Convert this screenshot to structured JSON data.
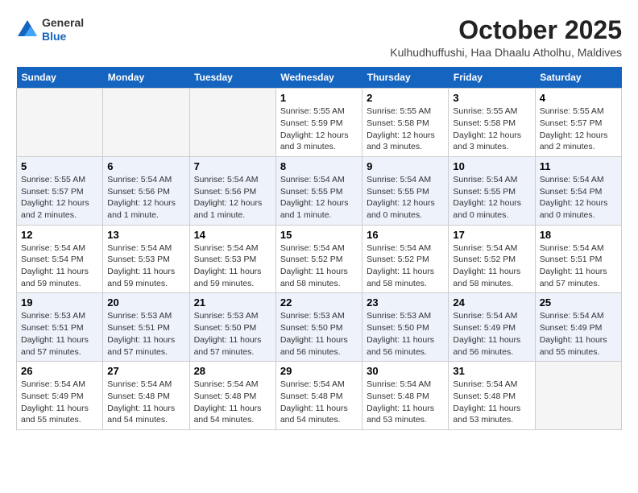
{
  "logo": {
    "general": "General",
    "blue": "Blue"
  },
  "header": {
    "month_year": "October 2025",
    "location": "Kulhudhuffushi, Haa Dhaalu Atholhu, Maldives"
  },
  "weekdays": [
    "Sunday",
    "Monday",
    "Tuesday",
    "Wednesday",
    "Thursday",
    "Friday",
    "Saturday"
  ],
  "weeks": [
    [
      {
        "day": "",
        "info": ""
      },
      {
        "day": "",
        "info": ""
      },
      {
        "day": "",
        "info": ""
      },
      {
        "day": "1",
        "info": "Sunrise: 5:55 AM\nSunset: 5:59 PM\nDaylight: 12 hours\nand 3 minutes."
      },
      {
        "day": "2",
        "info": "Sunrise: 5:55 AM\nSunset: 5:58 PM\nDaylight: 12 hours\nand 3 minutes."
      },
      {
        "day": "3",
        "info": "Sunrise: 5:55 AM\nSunset: 5:58 PM\nDaylight: 12 hours\nand 3 minutes."
      },
      {
        "day": "4",
        "info": "Sunrise: 5:55 AM\nSunset: 5:57 PM\nDaylight: 12 hours\nand 2 minutes."
      }
    ],
    [
      {
        "day": "5",
        "info": "Sunrise: 5:55 AM\nSunset: 5:57 PM\nDaylight: 12 hours\nand 2 minutes."
      },
      {
        "day": "6",
        "info": "Sunrise: 5:54 AM\nSunset: 5:56 PM\nDaylight: 12 hours\nand 1 minute."
      },
      {
        "day": "7",
        "info": "Sunrise: 5:54 AM\nSunset: 5:56 PM\nDaylight: 12 hours\nand 1 minute."
      },
      {
        "day": "8",
        "info": "Sunrise: 5:54 AM\nSunset: 5:55 PM\nDaylight: 12 hours\nand 1 minute."
      },
      {
        "day": "9",
        "info": "Sunrise: 5:54 AM\nSunset: 5:55 PM\nDaylight: 12 hours\nand 0 minutes."
      },
      {
        "day": "10",
        "info": "Sunrise: 5:54 AM\nSunset: 5:55 PM\nDaylight: 12 hours\nand 0 minutes."
      },
      {
        "day": "11",
        "info": "Sunrise: 5:54 AM\nSunset: 5:54 PM\nDaylight: 12 hours\nand 0 minutes."
      }
    ],
    [
      {
        "day": "12",
        "info": "Sunrise: 5:54 AM\nSunset: 5:54 PM\nDaylight: 11 hours\nand 59 minutes."
      },
      {
        "day": "13",
        "info": "Sunrise: 5:54 AM\nSunset: 5:53 PM\nDaylight: 11 hours\nand 59 minutes."
      },
      {
        "day": "14",
        "info": "Sunrise: 5:54 AM\nSunset: 5:53 PM\nDaylight: 11 hours\nand 59 minutes."
      },
      {
        "day": "15",
        "info": "Sunrise: 5:54 AM\nSunset: 5:52 PM\nDaylight: 11 hours\nand 58 minutes."
      },
      {
        "day": "16",
        "info": "Sunrise: 5:54 AM\nSunset: 5:52 PM\nDaylight: 11 hours\nand 58 minutes."
      },
      {
        "day": "17",
        "info": "Sunrise: 5:54 AM\nSunset: 5:52 PM\nDaylight: 11 hours\nand 58 minutes."
      },
      {
        "day": "18",
        "info": "Sunrise: 5:54 AM\nSunset: 5:51 PM\nDaylight: 11 hours\nand 57 minutes."
      }
    ],
    [
      {
        "day": "19",
        "info": "Sunrise: 5:53 AM\nSunset: 5:51 PM\nDaylight: 11 hours\nand 57 minutes."
      },
      {
        "day": "20",
        "info": "Sunrise: 5:53 AM\nSunset: 5:51 PM\nDaylight: 11 hours\nand 57 minutes."
      },
      {
        "day": "21",
        "info": "Sunrise: 5:53 AM\nSunset: 5:50 PM\nDaylight: 11 hours\nand 57 minutes."
      },
      {
        "day": "22",
        "info": "Sunrise: 5:53 AM\nSunset: 5:50 PM\nDaylight: 11 hours\nand 56 minutes."
      },
      {
        "day": "23",
        "info": "Sunrise: 5:53 AM\nSunset: 5:50 PM\nDaylight: 11 hours\nand 56 minutes."
      },
      {
        "day": "24",
        "info": "Sunrise: 5:54 AM\nSunset: 5:49 PM\nDaylight: 11 hours\nand 56 minutes."
      },
      {
        "day": "25",
        "info": "Sunrise: 5:54 AM\nSunset: 5:49 PM\nDaylight: 11 hours\nand 55 minutes."
      }
    ],
    [
      {
        "day": "26",
        "info": "Sunrise: 5:54 AM\nSunset: 5:49 PM\nDaylight: 11 hours\nand 55 minutes."
      },
      {
        "day": "27",
        "info": "Sunrise: 5:54 AM\nSunset: 5:48 PM\nDaylight: 11 hours\nand 54 minutes."
      },
      {
        "day": "28",
        "info": "Sunrise: 5:54 AM\nSunset: 5:48 PM\nDaylight: 11 hours\nand 54 minutes."
      },
      {
        "day": "29",
        "info": "Sunrise: 5:54 AM\nSunset: 5:48 PM\nDaylight: 11 hours\nand 54 minutes."
      },
      {
        "day": "30",
        "info": "Sunrise: 5:54 AM\nSunset: 5:48 PM\nDaylight: 11 hours\nand 53 minutes."
      },
      {
        "day": "31",
        "info": "Sunrise: 5:54 AM\nSunset: 5:48 PM\nDaylight: 11 hours\nand 53 minutes."
      },
      {
        "day": "",
        "info": ""
      }
    ]
  ]
}
